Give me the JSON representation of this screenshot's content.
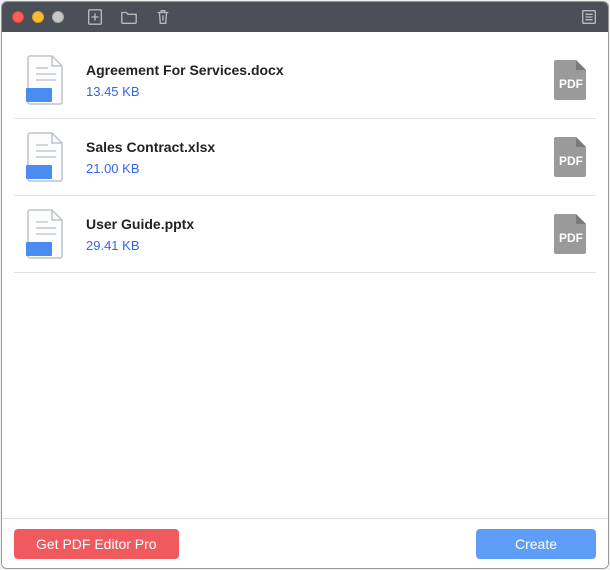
{
  "titlebar": {
    "icons": {
      "add": "add-file-icon",
      "folder": "folder-icon",
      "trash": "trash-icon",
      "list": "list-view-icon"
    }
  },
  "files": [
    {
      "name": "Agreement For Services.docx",
      "size": "13.45 KB"
    },
    {
      "name": "Sales Contract.xlsx",
      "size": "21.00 KB"
    },
    {
      "name": "User Guide.pptx",
      "size": "29.41 KB"
    }
  ],
  "pdf_label": "PDF",
  "footer": {
    "promo_label": "Get PDF Editor Pro",
    "create_label": "Create"
  }
}
